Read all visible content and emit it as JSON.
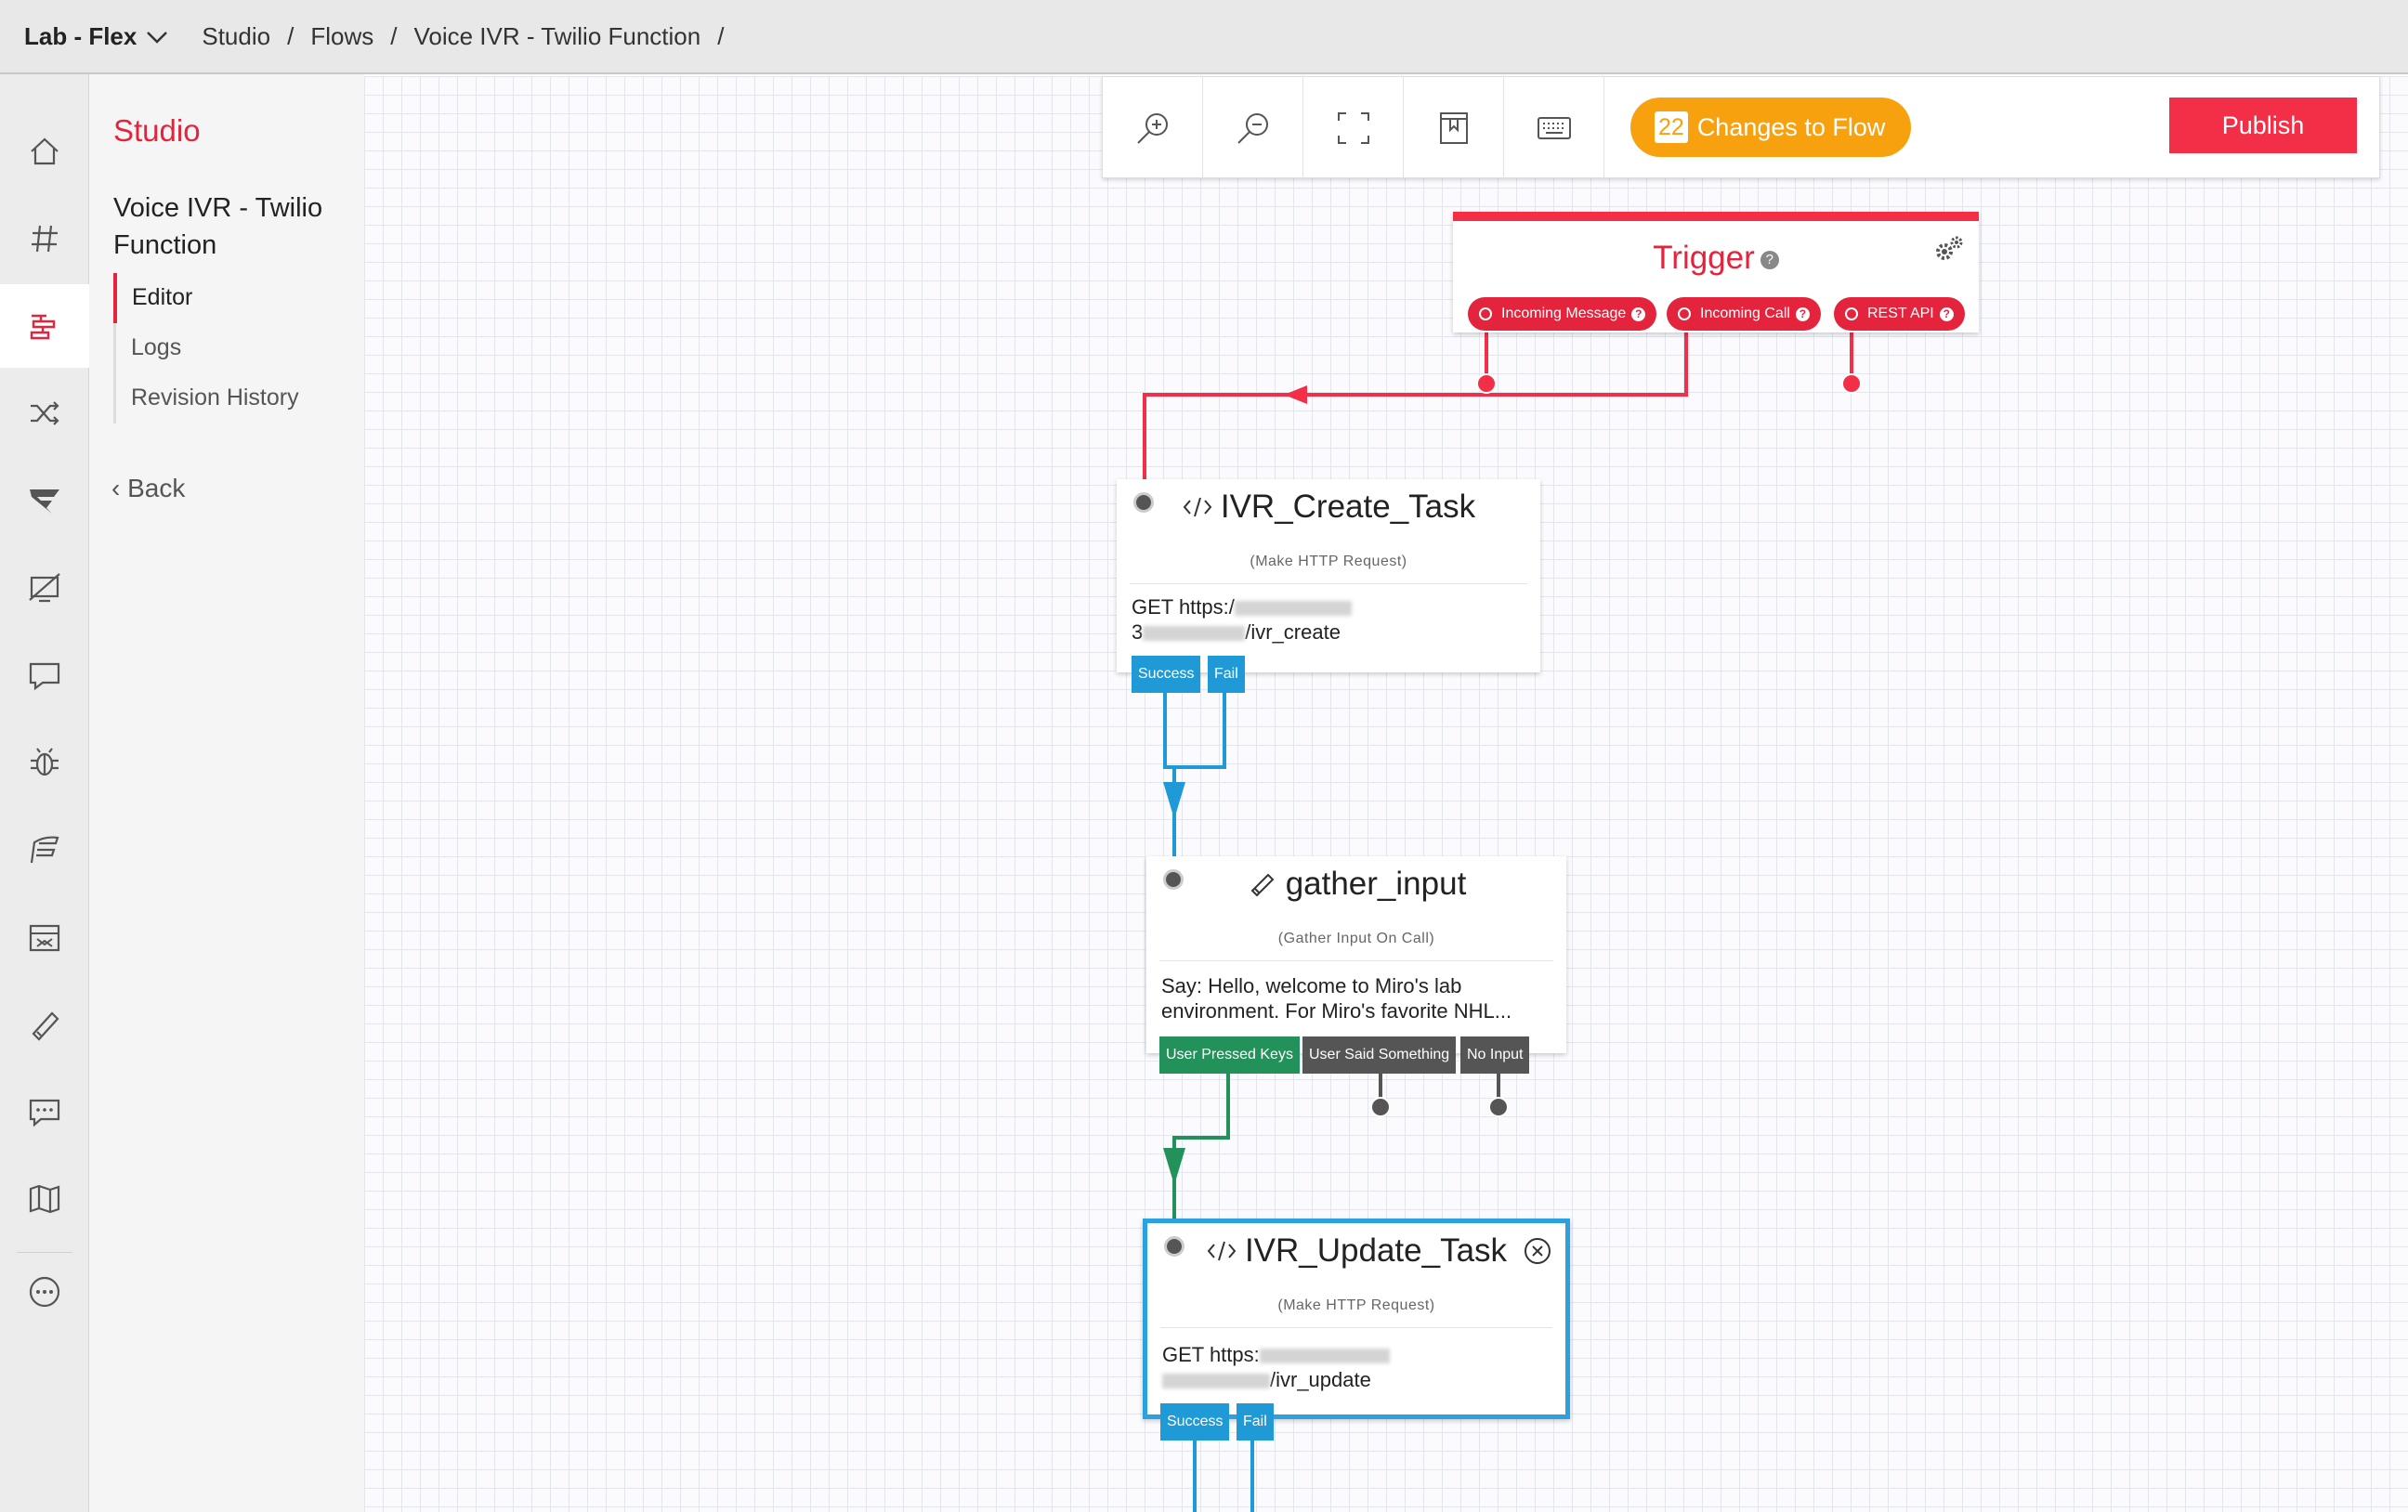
{
  "topbar": {
    "account": "Lab - Flex",
    "breadcrumbs": [
      "Studio",
      "Flows",
      "Voice IVR - Twilio Function"
    ],
    "separator": "/"
  },
  "sidebar": {
    "section": "Studio",
    "flow_name": "Voice IVR - Twilio Function",
    "items": [
      {
        "label": "Editor",
        "active": true
      },
      {
        "label": "Logs",
        "active": false
      },
      {
        "label": "Revision History",
        "active": false
      }
    ],
    "back_label": "Back"
  },
  "rail": {
    "icons": [
      "home-icon",
      "hashtag-icon",
      "studio-flow-icon",
      "shuffle-icon",
      "flex-icon",
      "monitor-icon",
      "chat-icon",
      "bug-icon",
      "wing-icon",
      "sync-icon",
      "phone-icon",
      "message-icon",
      "map-icon",
      "more-icon"
    ],
    "active_index": 2
  },
  "toolbar": {
    "changes_count": "22",
    "changes_label": "Changes to Flow",
    "publish_label": "Publish",
    "changes_color": "#f8a10f",
    "publish_color": "#f22f46"
  },
  "trigger": {
    "title": "Trigger",
    "help": "?",
    "ports": [
      "Incoming Message",
      "Incoming Call",
      "REST API"
    ]
  },
  "nodes": [
    {
      "title": "IVR_Create_Task",
      "subtitle": "(Make HTTP Request)",
      "body_line1": "GET https:/",
      "body_line2_prefix": "3",
      "body_line2_suffix": "/ivr_create",
      "ports": [
        "Success",
        "Fail"
      ]
    },
    {
      "title": "gather_input",
      "subtitle": "(Gather Input On Call)",
      "body_line1": "Say: Hello, welcome to Miro's lab",
      "body_line2": "environment. For Miro's favorite NHL...",
      "ports": [
        "User Pressed Keys",
        "User Said Something",
        "No Input"
      ]
    },
    {
      "title": "IVR_Update_Task",
      "subtitle": "(Make HTTP Request)",
      "body_line1": "GET https:",
      "body_line2_prefix": "",
      "body_line2_suffix": "/ivr_update",
      "ports": [
        "Success",
        "Fail"
      ]
    }
  ]
}
